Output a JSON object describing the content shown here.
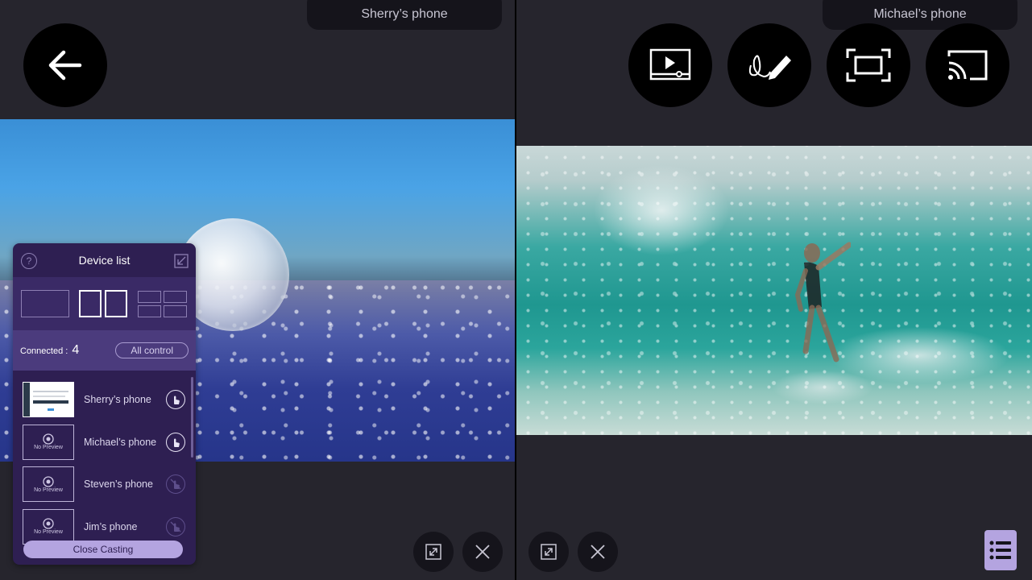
{
  "left_pane": {
    "device_name": "Sherry’s phone"
  },
  "right_pane": {
    "device_name": "Michael’s phone"
  },
  "device_panel": {
    "title": "Device list",
    "connected_label": "Connected :",
    "connected_count": "4",
    "all_control_label": "All control",
    "close_label": "Close Casting",
    "devices": [
      {
        "name": "Sherry’s phone",
        "preview": true,
        "control_enabled": true
      },
      {
        "name": "Michael’s phone",
        "preview": false,
        "preview_text": "No Preview",
        "control_enabled": true
      },
      {
        "name": "Steven’s phone",
        "preview": false,
        "preview_text": "No Preview",
        "control_enabled": false
      },
      {
        "name": "Jim’s phone",
        "preview": false,
        "preview_text": "No Preview",
        "control_enabled": false
      }
    ],
    "selected_layout": "split-2"
  },
  "colors": {
    "background": "#26252d",
    "panel": "#2e1f52",
    "accent": "#b4a4e0"
  },
  "icons": [
    "back-arrow-icon",
    "video-player-icon",
    "draw-pen-icon",
    "fullscreen-icon",
    "cast-icon",
    "expand-icon",
    "close-icon",
    "list-menu-icon",
    "help-icon",
    "minimize-icon",
    "touch-control-icon",
    "eye-icon"
  ]
}
